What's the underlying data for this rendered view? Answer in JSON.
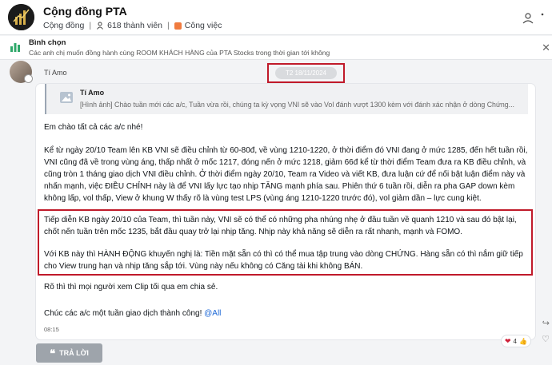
{
  "group": {
    "title": "Cộng đồng PTA",
    "type": "Cộng đồng",
    "members": "618 thành viên",
    "tag": "Công việc"
  },
  "poll": {
    "title": "Bình chọn",
    "description": "Các anh chị muốn đồng hành cùng ROOM KHÁCH HÀNG của PTA Stocks trong thời gian tới không"
  },
  "message": {
    "sender": "Tí Amo",
    "date": "T2 18/11/2024",
    "quote": {
      "name": "Tí Amo",
      "text": "[Hình ảnh] Chào tuần mới các a/c, Tuần vừa rồi, chúng ta kỳ vọng VNI sẽ vào Vol đánh vượt 1300 kèm với đánh xác nhận ở dòng Chứng..."
    },
    "paragraphs": {
      "p1": "Em chào tất cả các a/c nhé!",
      "p2": "Kể từ ngày 20/10 Team lên KB VNI sẽ điều chỉnh từ 60-80đ, về vùng 1210-1220, ở thời điểm đó VNI đang ở mức 1285, đến hết tuần rồi, VNI cũng đã về trong vùng áng, thấp nhất ở mốc 1217, đóng nến ở mức 1218, giảm 66đ kể từ thời điểm Team đưa ra KB điều chỉnh, và cũng tròn 1 tháng giao dịch VNI điều chỉnh. Ở thời điểm ngày 20/10, Team ra Video và viết KB, đưa luận cứ để nối bật luận điểm này và nhấn mạnh, việc ĐIỀU CHỈNH này là để VNI lấy lực tạo nhịp TĂNG mạnh phía sau. Phiên thứ 6 tuần rồi, diễn ra pha GAP down kèm không lấp, vol thấp, View ở khung W thấy rõ là vùng test LPS (vùng áng 1210-1220 trước đó), vol giảm dần – lực cung kiệt.",
      "p3": "Tiếp diễn KB ngày 20/10 của Team, thì tuần này, VNI sẽ có thể có những pha nhúng nhẹ ở đầu tuần về quanh 1210 và sau đó bật lại, chốt nến tuần trên mốc 1235, bắt đầu quay trở lại nhịp tăng. Nhịp này khả năng sẽ diễn ra rất nhanh, mạnh và FOMO.",
      "p4": "Với KB này thì HÀNH ĐỘNG khuyến nghị là: Tiền mặt sẵn có thì có thể mua tập trung vào dòng CHỨNG. Hàng sẵn có thì nắm giữ tiếp cho View trung hạn và nhịp tăng sắp tới. Vùng này nếu không có Căng tài khi không BÁN.",
      "p5": "Rõ thì thì mọi người xem Clip tối qua em chia sẻ.",
      "p6": "Chúc các a/c một tuần giao dịch thành công!",
      "p6_link": "@All"
    },
    "time": "08:15",
    "reaction_count": "4"
  },
  "reply_label": "TRẢ LỜI",
  "colors": {
    "highlight": "#c01a2a",
    "link": "#1a66d6",
    "tag": "#f07b3f"
  }
}
